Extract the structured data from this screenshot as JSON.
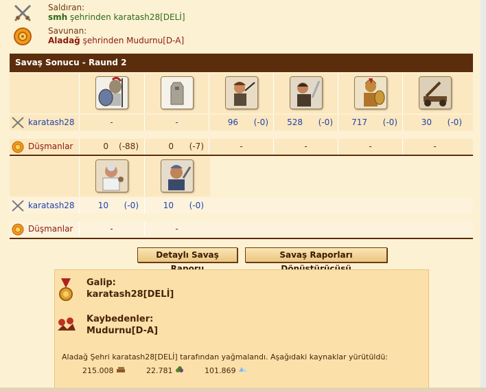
{
  "attacker": {
    "label": "Saldıran:",
    "player": "smh",
    "rest": " şehrinden karatash28[DELİ]"
  },
  "defender": {
    "label": "Savunan:",
    "player": "Aladağ",
    "rest": " şehrinden Mudurnu[D-A]"
  },
  "section_title": "Savaş Sonucu - Raund 2",
  "row_player_name": "karatash28",
  "row_enemy_name": "Düşmanlar",
  "row1": {
    "units": [
      "hoplite-icon",
      "wall-icon",
      "slinger-icon",
      "swordsman-icon",
      "spartan-icon",
      "catapult-icon"
    ],
    "player": [
      {
        "c": "-"
      },
      {
        "c": "-"
      },
      {
        "a": "96",
        "b": "(-0)"
      },
      {
        "a": "528",
        "b": "(-0)"
      },
      {
        "a": "717",
        "b": "(-0)"
      },
      {
        "a": "30",
        "b": "(-0)"
      }
    ],
    "enemy": [
      {
        "a": "0",
        "b": "(-88)"
      },
      {
        "a": "0",
        "b": "(-7)"
      },
      {
        "c": "-"
      },
      {
        "c": "-"
      },
      {
        "c": "-"
      },
      {
        "c": "-"
      }
    ]
  },
  "row2": {
    "units": [
      "doctor-icon",
      "cook-icon"
    ],
    "player": [
      {
        "a": "10",
        "b": "(-0)"
      },
      {
        "a": "10",
        "b": "(-0)"
      }
    ],
    "enemy": [
      {
        "c": "-"
      },
      {
        "c": "-"
      }
    ]
  },
  "buttons": {
    "detailed": "Detaylı Savaş Raporu",
    "converter": "Savaş Raporları Dönüştürücüsü"
  },
  "summary": {
    "winner_label": "Galip:",
    "winner": "karatash28[DELİ]",
    "loser_label": "Kaybedenler:",
    "loser": "Mudurnu[D-A]",
    "pillage_text": "Aladağ Şehri karatash28[DELİ] tarafından yağmalandı. Aşağıdaki kaynaklar yürütüldü:",
    "resources": [
      {
        "value": "215.008",
        "icon": "wood-icon"
      },
      {
        "value": "22.781",
        "icon": "wine-icon"
      },
      {
        "value": "101.869",
        "icon": "crystal-icon"
      }
    ]
  }
}
